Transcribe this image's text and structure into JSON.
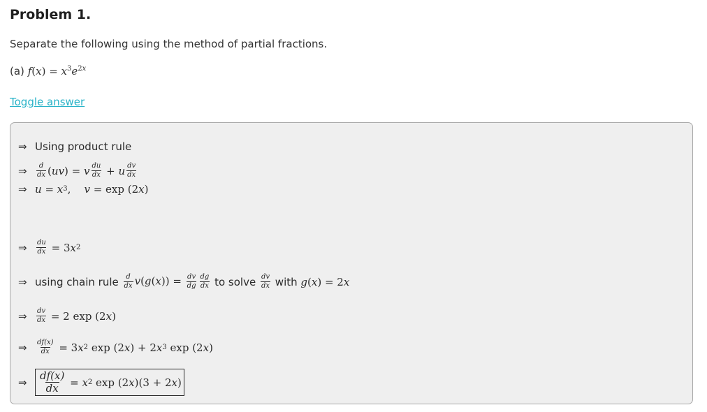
{
  "problem_title": "Problem 1.",
  "intro_text": "Separate the following using the method of partial fractions.",
  "part_a": {
    "label": "(a)",
    "equation": "f(x) = x³e^{2x}"
  },
  "toggle_label": "Toggle answer",
  "answer_lines": [
    "⇒ Using product rule",
    "⇒ d/dx (uv) = v du/dx + u dv/dx",
    "⇒ u = x³,  v = exp(2x)",
    "⇒ du/dx = 3x²",
    "⇒ using chain rule d/dx v(g(x)) = dv/dg dg/dx to solve dv/dx with g(x) = 2x",
    "⇒ dv/dx = 2 exp(2x)",
    "⇒ df(x)/dx = 3x² exp(2x) + 2x³ exp(2x)",
    "⇒ df(x)/dx = x² exp(2x)(3 + 2x)"
  ],
  "words": {
    "using_product_rule": "Using product rule",
    "using_chain_rule": "using chain rule",
    "to_solve": "to solve",
    "with": "with"
  }
}
